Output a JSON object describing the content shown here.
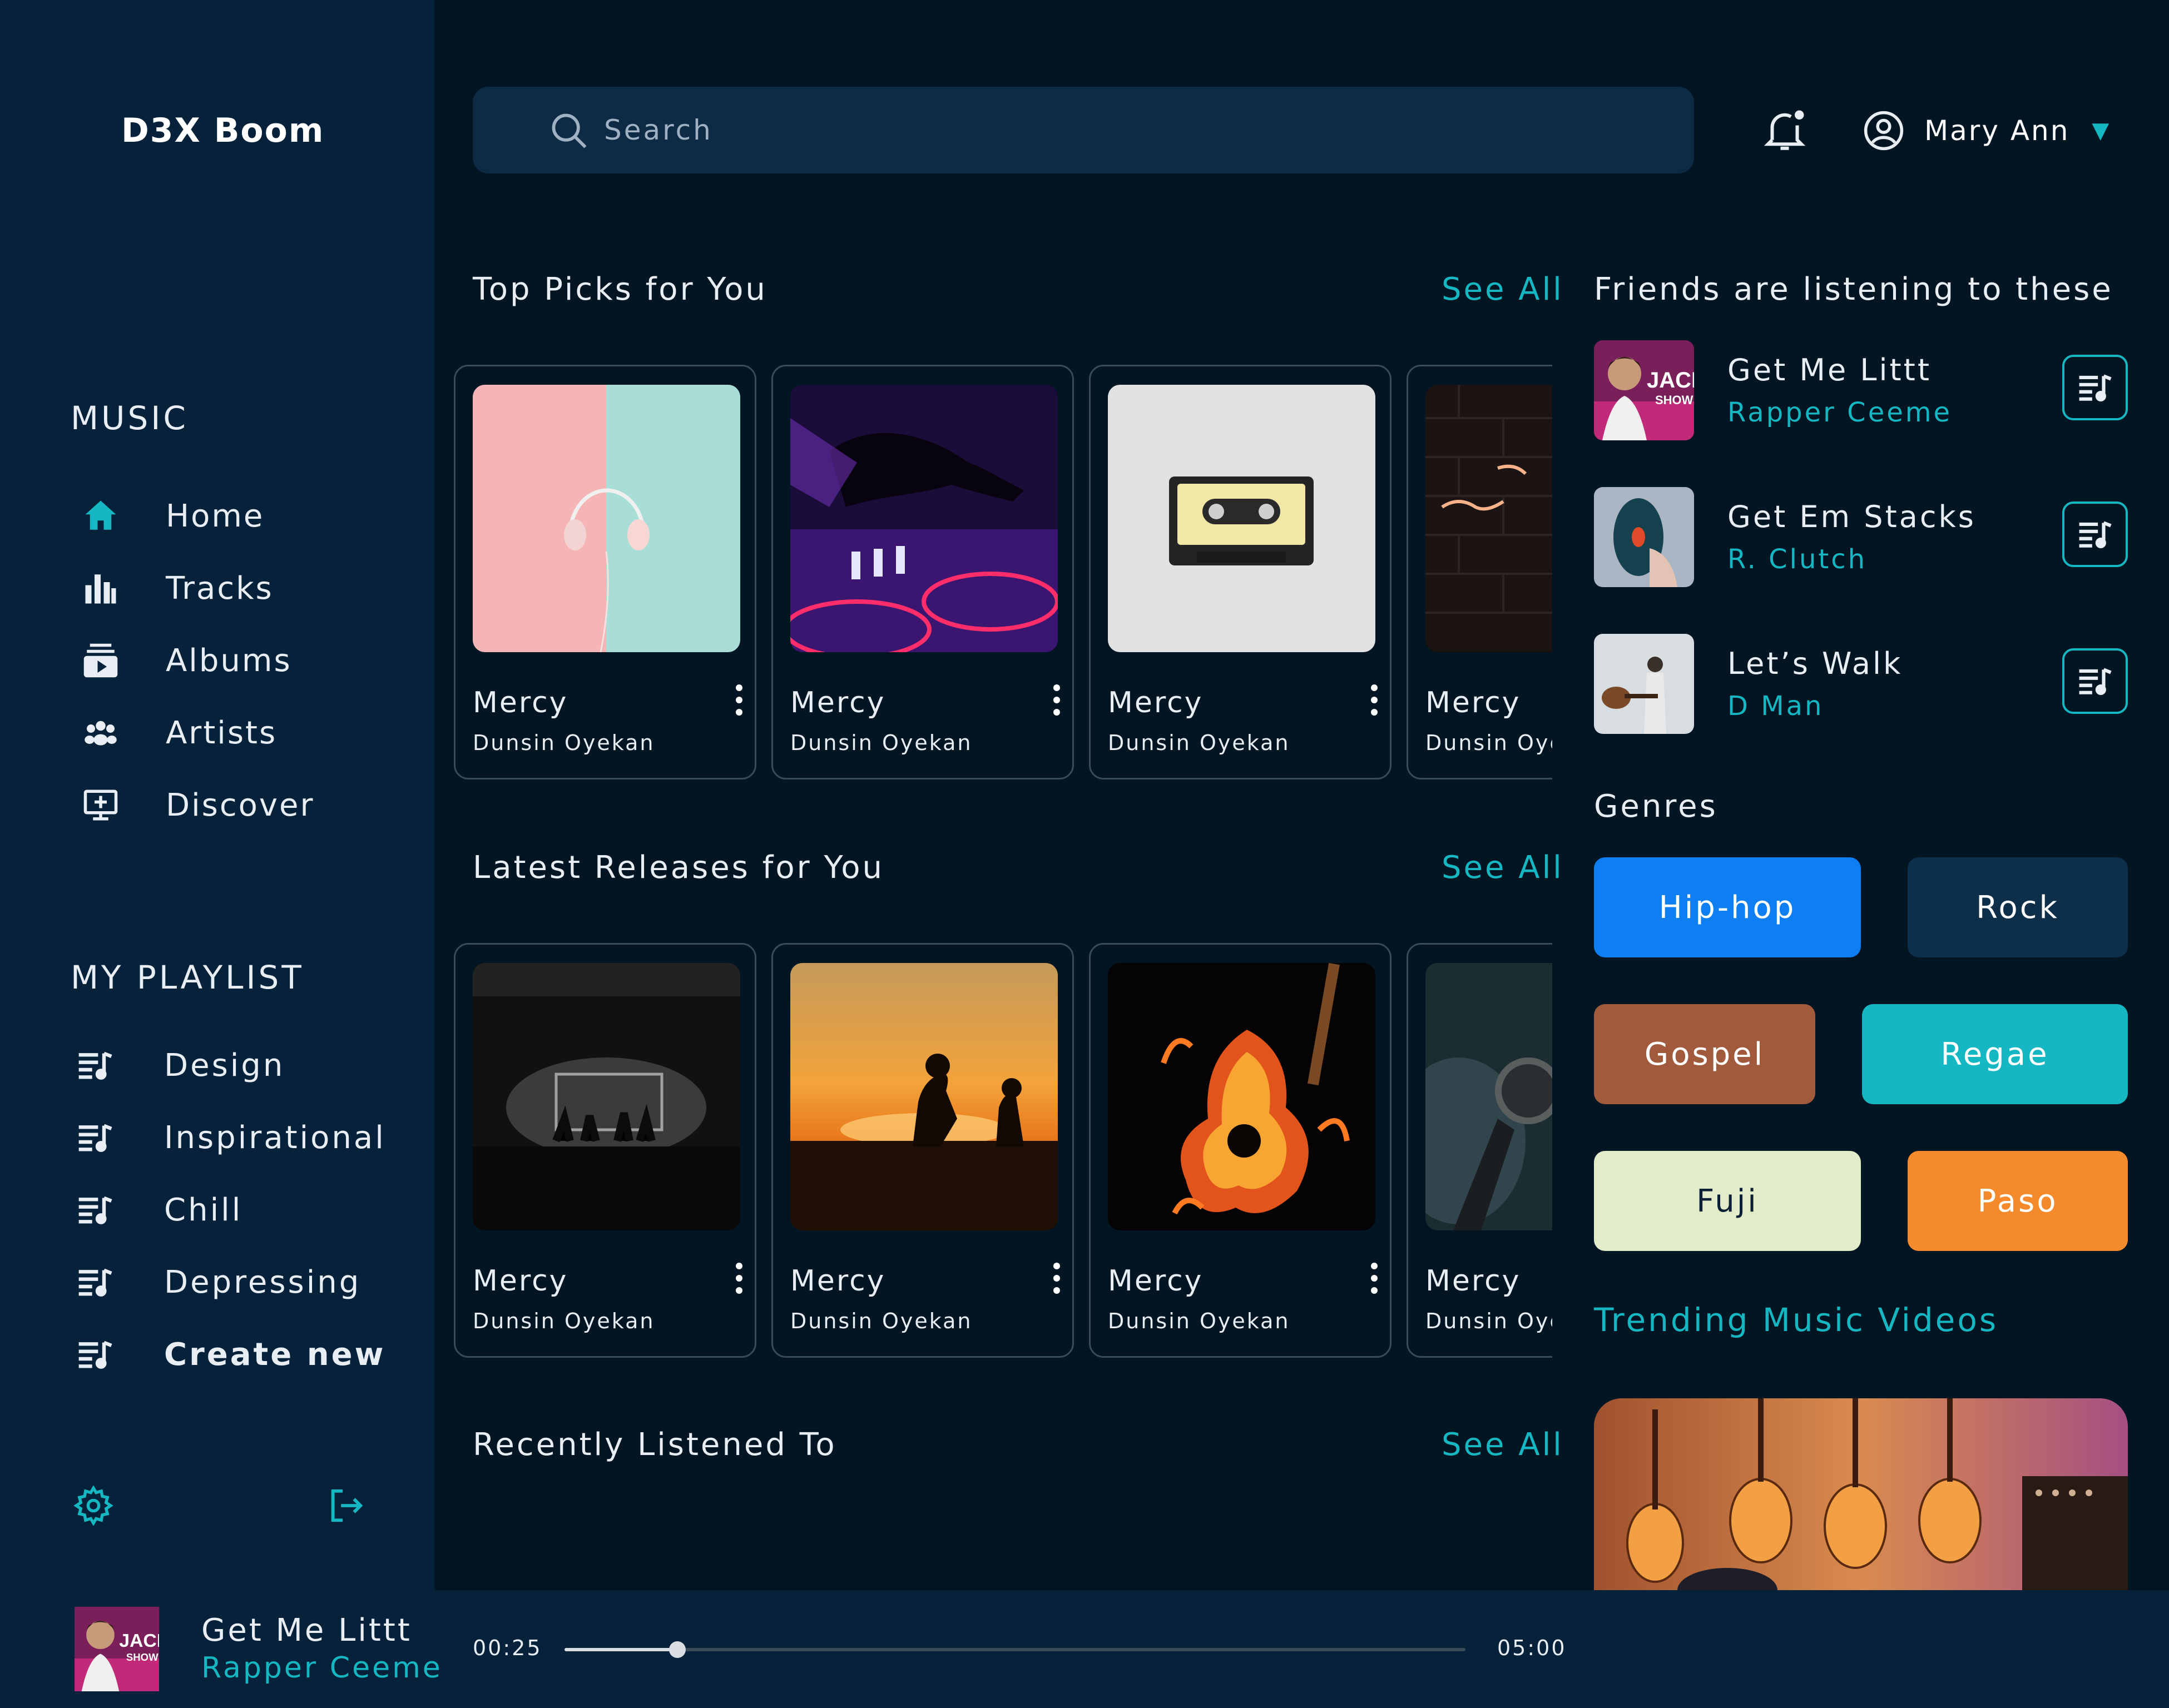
{
  "app": {
    "brand": "D3X Boom"
  },
  "sidebar": {
    "music_heading": "MUSIC",
    "nav": [
      {
        "label": "Home",
        "icon": "home-icon"
      },
      {
        "label": "Tracks",
        "icon": "bar-chart-icon"
      },
      {
        "label": "Albums",
        "icon": "album-icon"
      },
      {
        "label": "Artists",
        "icon": "artists-icon"
      },
      {
        "label": "Discover",
        "icon": "discover-icon"
      }
    ],
    "playlist_heading": "MY PLAYLIST",
    "playlists": [
      {
        "label": "Design"
      },
      {
        "label": "Inspirational"
      },
      {
        "label": "Chill"
      },
      {
        "label": "Depressing"
      },
      {
        "label": "Create new"
      }
    ],
    "bottom_icons": [
      "settings-icon",
      "logout-icon"
    ]
  },
  "header": {
    "search_placeholder": "Search",
    "user_name": "Mary Ann",
    "caret": "▼"
  },
  "sections": {
    "top_picks": {
      "title": "Top Picks for You",
      "see_all": "See All",
      "cards": [
        {
          "title": "Mercy",
          "artist": "Dunsin Oyekan"
        },
        {
          "title": "Mercy",
          "artist": "Dunsin Oyekan"
        },
        {
          "title": "Mercy",
          "artist": "Dunsin Oyekan"
        },
        {
          "title": "Mercy",
          "artist": "Dunsin Oyekan"
        }
      ]
    },
    "latest": {
      "title": "Latest Releases for You",
      "see_all": "See All",
      "cards": [
        {
          "title": "Mercy",
          "artist": "Dunsin Oyekan"
        },
        {
          "title": "Mercy",
          "artist": "Dunsin Oyekan"
        },
        {
          "title": "Mercy",
          "artist": "Dunsin Oyekan"
        },
        {
          "title": "Mercy",
          "artist": "Dunsin Oyekan"
        }
      ]
    },
    "recent": {
      "title": "Recently Listened To",
      "see_all": "See All"
    }
  },
  "right_panel": {
    "friends_title": "Friends are listening to these",
    "friends": [
      {
        "title": "Get Me Littt",
        "artist": "Rapper Ceeme"
      },
      {
        "title": "Get Em Stacks",
        "artist": "R. Clutch"
      },
      {
        "title": "Let’s Walk",
        "artist": "D Man"
      }
    ],
    "genres_title": "Genres",
    "genres": [
      {
        "label": "Hip-hop",
        "bg": "#0d7ff2",
        "fg": "#ffffff"
      },
      {
        "label": "Rock",
        "bg": "#0e2f4a",
        "fg": "#ffffff"
      },
      {
        "label": "Gospel",
        "bg": "#a25a3d",
        "fg": "#ffffff"
      },
      {
        "label": "Regae",
        "bg": "#15b8c2",
        "fg": "#ffffff"
      },
      {
        "label": "Fuji",
        "bg": "#e3ecc8",
        "fg": "#0b2034"
      },
      {
        "label": "Paso",
        "bg": "#f58a2c",
        "fg": "#ffffff"
      }
    ],
    "trending_title": "Trending Music Videos"
  },
  "player": {
    "title": "Get Me Littt",
    "artist": "Rapper Ceeme",
    "current_time": "00:25",
    "duration": "05:00",
    "progress": 0.125
  },
  "colors": {
    "accent": "#15b8c2",
    "background": "#011523",
    "sidebar": "#05223a"
  }
}
